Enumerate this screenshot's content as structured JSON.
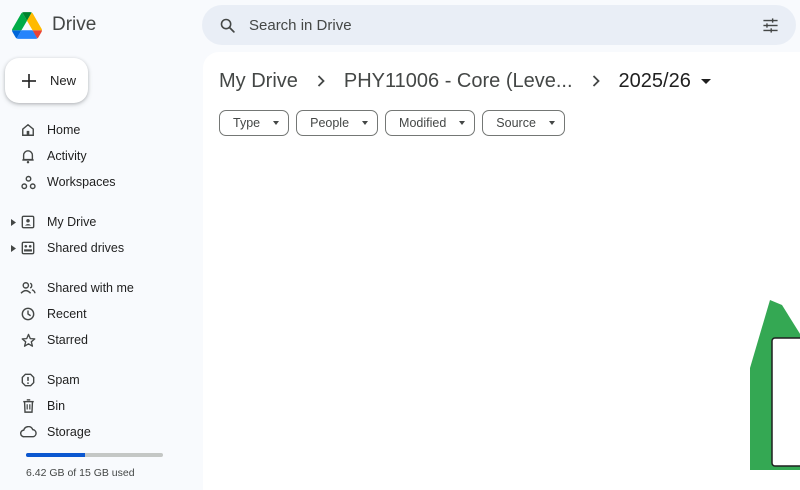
{
  "app": {
    "name": "Drive",
    "logo_icon": "google-drive-logo"
  },
  "search": {
    "placeholder": "Search in Drive",
    "icon": "search-icon",
    "options_icon": "tune-icon"
  },
  "new_button": {
    "label": "New",
    "icon": "plus-icon"
  },
  "sidebar": {
    "items": [
      {
        "label": "Home",
        "icon": "home-icon"
      },
      {
        "label": "Activity",
        "icon": "bell-icon"
      },
      {
        "label": "Workspaces",
        "icon": "workspaces-icon"
      },
      {
        "label": "My Drive",
        "icon": "my-drive-icon",
        "expandable": true
      },
      {
        "label": "Shared drives",
        "icon": "shared-drives-icon",
        "expandable": true
      },
      {
        "label": "Shared with me",
        "icon": "people-icon"
      },
      {
        "label": "Recent",
        "icon": "clock-icon"
      },
      {
        "label": "Starred",
        "icon": "star-icon"
      },
      {
        "label": "Spam",
        "icon": "spam-icon"
      },
      {
        "label": "Bin",
        "icon": "trash-icon"
      },
      {
        "label": "Storage",
        "icon": "cloud-icon"
      }
    ]
  },
  "storage": {
    "used_text": "6.42 GB of 15 GB used",
    "used_fraction": 0.428
  },
  "breadcrumb": {
    "items": [
      "My Drive",
      "PHY11006 - Core (Leve..."
    ],
    "current": "2025/26"
  },
  "filters": [
    {
      "label": "Type"
    },
    {
      "label": "People"
    },
    {
      "label": "Modified"
    },
    {
      "label": "Source"
    }
  ],
  "colors": {
    "accent": "#0b57d0",
    "background": "#f8fafd",
    "search_bg": "#e9eef6"
  }
}
